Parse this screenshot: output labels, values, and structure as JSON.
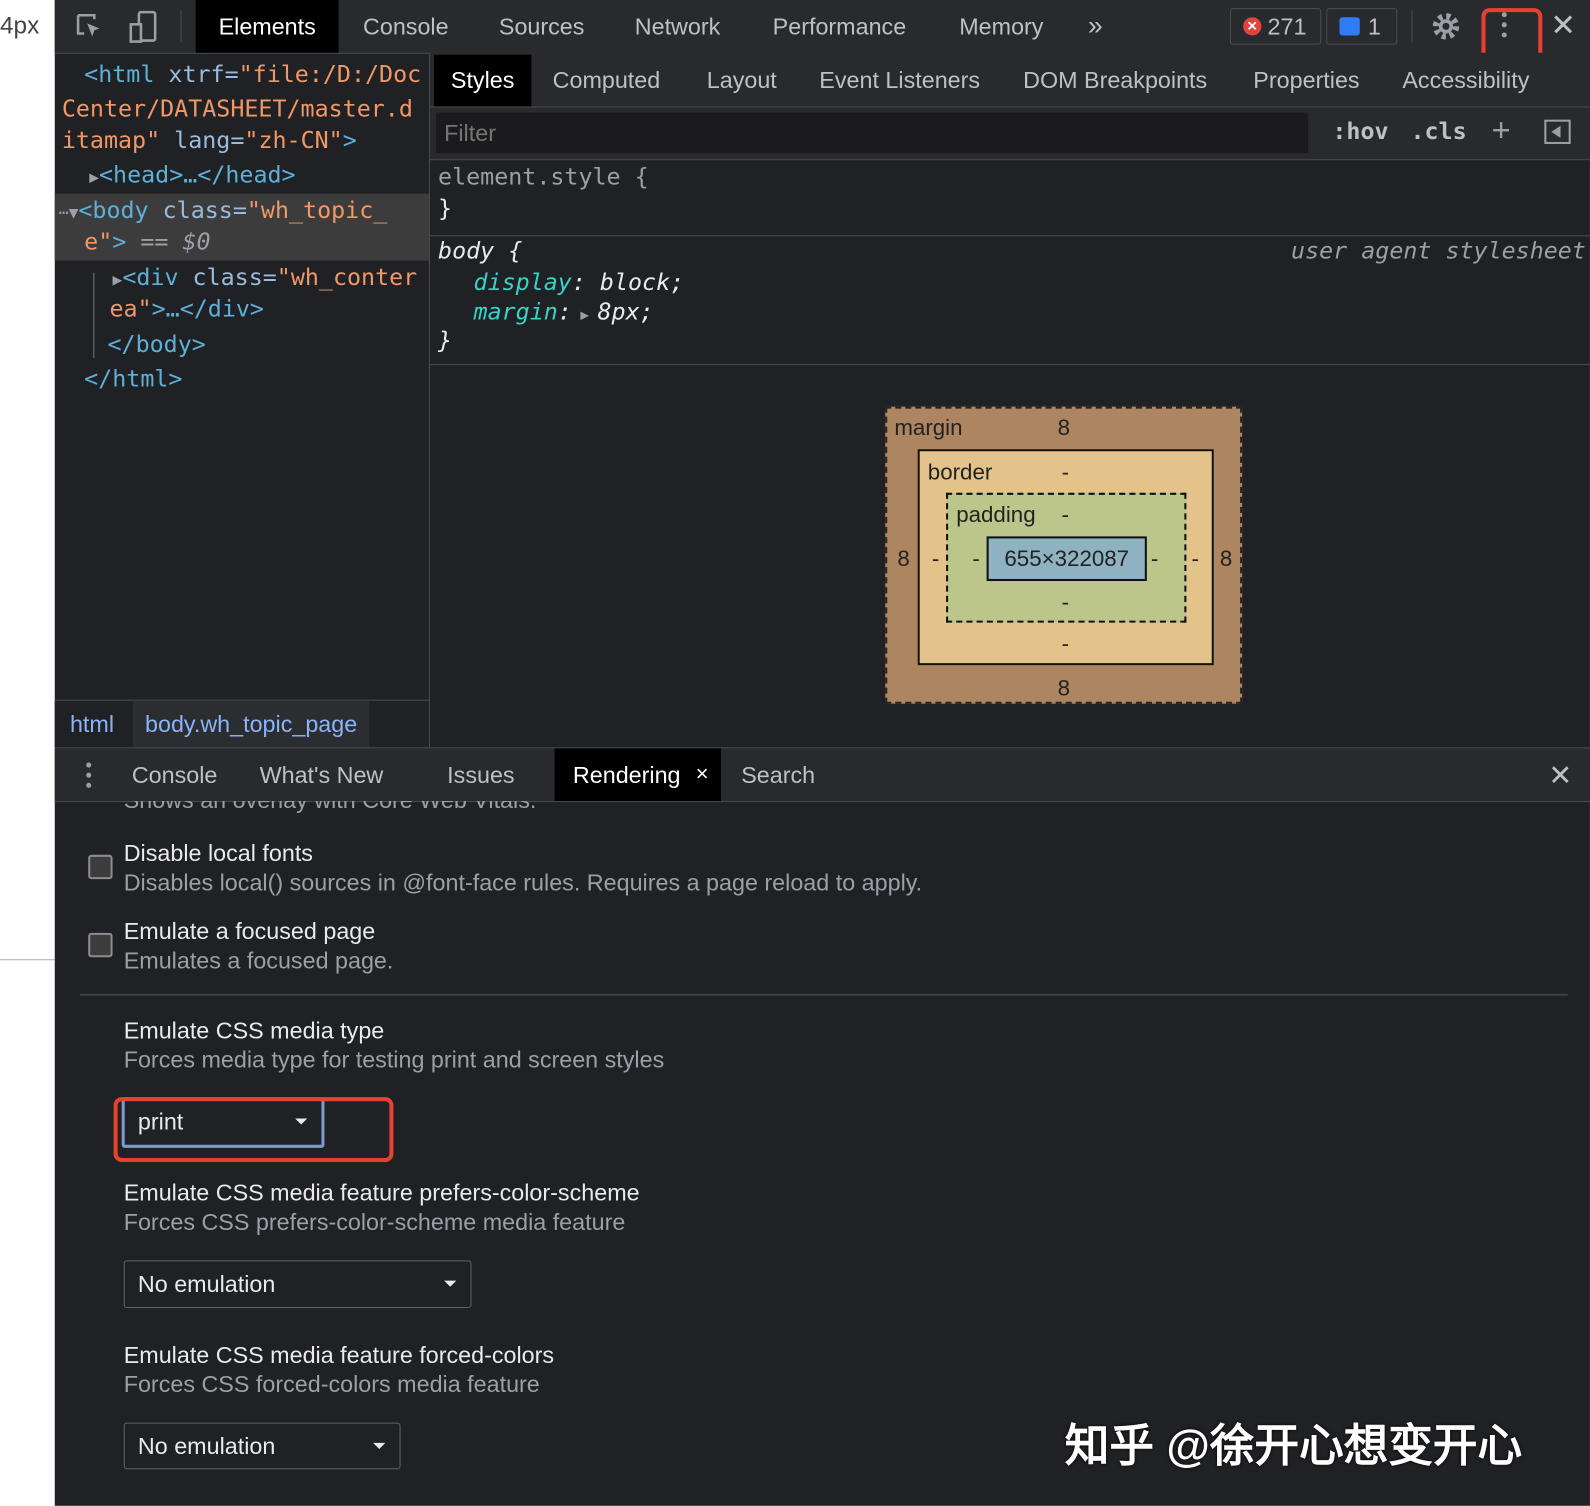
{
  "page_edge_text": "4px",
  "toolbar": {
    "tabs": [
      "Elements",
      "Console",
      "Sources",
      "Network",
      "Performance",
      "Memory"
    ],
    "more_tabs": "»",
    "error_count": "271",
    "message_count": "1"
  },
  "elements": {
    "lines": {
      "html_open_1a": "<html ",
      "html_open_1b": "xtrf=",
      "html_open_1c": "\"file:/D:/Doc",
      "html_open_2": "Center/DATASHEET/master.d",
      "html_open_3a": "itamap\" ",
      "html_open_3b": "lang=",
      "html_open_3c": "\"zh-CN\"",
      "html_open_3d": ">",
      "head": "<head>…</head>",
      "body_1a": "<body ",
      "body_1b": "class=",
      "body_1c": "\"wh_topic_",
      "body_2a": "e\"",
      "body_2b": ">",
      "body_2c": " == $0",
      "div_1a": "<div ",
      "div_1b": "class=",
      "div_1c": "\"wh_conter",
      "div_2a": "ea\"",
      "div_2b": ">…</div>",
      "body_close": "</body>",
      "html_close": "</html>"
    },
    "breadcrumbs": [
      "html",
      "body.wh_topic_page"
    ]
  },
  "styles": {
    "subtabs": [
      "Styles",
      "Computed",
      "Layout",
      "Event Listeners",
      "DOM Breakpoints",
      "Properties",
      "Accessibility"
    ],
    "filter_placeholder": "Filter",
    "hov": ":hov",
    "cls": ".cls",
    "element_style_open": "element.style {",
    "close_brace": "}",
    "body_rule_open": "body {",
    "source": "user agent stylesheet",
    "declarations": [
      {
        "prop": "display",
        "value": "block;"
      },
      {
        "prop": "margin",
        "value": "8px;"
      }
    ]
  },
  "box_model": {
    "margin_label": "margin",
    "margin_top": "8",
    "margin_right": "8",
    "margin_bottom": "8",
    "margin_left": "8",
    "border_label": "border",
    "border_top": "-",
    "border_right": "-",
    "border_bottom": "-",
    "border_left": "-",
    "padding_label": "padding",
    "padding_top": "-",
    "padding_right": "-",
    "padding_bottom": "-",
    "padding_left": "-",
    "content_size": "655×322087"
  },
  "drawer": {
    "tabs": [
      "Console",
      "What's New",
      "Issues",
      "Rendering",
      "Search"
    ],
    "active_tab_close": "×"
  },
  "rendering": {
    "cut_text": "Shows an overlay with Core Web Vitals.",
    "options": [
      {
        "title": "Disable local fonts",
        "desc": "Disables local() sources in @font-face rules. Requires a page reload to apply.",
        "checked": false
      },
      {
        "title": "Emulate a focused page",
        "desc": "Emulates a focused page.",
        "checked": false
      }
    ],
    "media_type": {
      "title": "Emulate CSS media type",
      "desc": "Forces media type for testing print and screen styles",
      "value": "print"
    },
    "color_scheme": {
      "title": "Emulate CSS media feature prefers-color-scheme",
      "desc": "Forces CSS prefers-color-scheme media feature",
      "value": "No emulation"
    },
    "forced_colors": {
      "title": "Emulate CSS media feature forced-colors",
      "desc": "Forces CSS forced-colors media feature",
      "value": "No emulation"
    }
  },
  "watermark": "知乎 @徐开心想变开心",
  "colors": {
    "highlight_red": "#e8412f",
    "accent_blue": "#8ab4f8",
    "error_red": "#e0443e",
    "message_blue": "#2f7cf6"
  }
}
